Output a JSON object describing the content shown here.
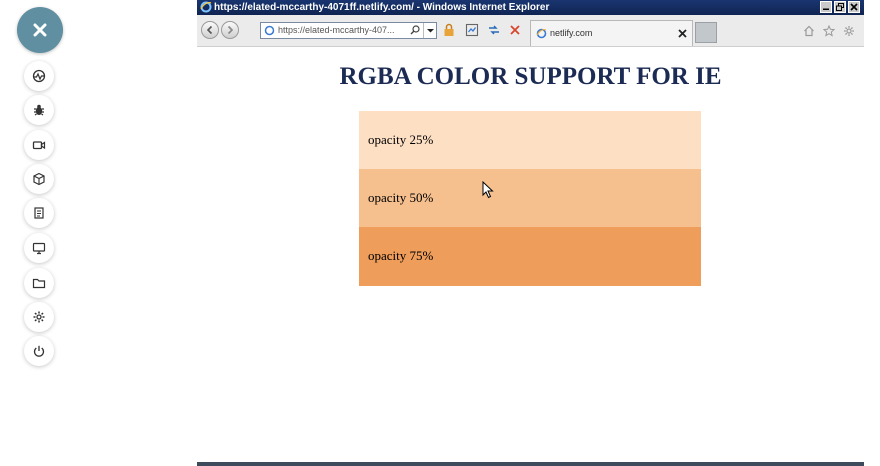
{
  "window": {
    "title": "https://elated-mccarthy-4071ff.netlify.com/ - Windows Internet Explorer"
  },
  "toolbar": {
    "address": "https://elated-mccarthy-407...",
    "tab_title": "netlify.com"
  },
  "page": {
    "heading": "RGBA COLOR SUPPORT FOR IE",
    "swatches": [
      {
        "label": "opacity 25%",
        "color": "#fddfc4"
      },
      {
        "label": "opacity 50%",
        "color": "#f5bf8e"
      },
      {
        "label": "opacity 75%",
        "color": "#ee9d5a"
      }
    ]
  },
  "colors": {
    "rail_button": "#5f8fa0",
    "titlebar": "#1a3570",
    "heading": "#1c2b53"
  },
  "icons": {
    "rail": [
      "close-icon",
      "speedometer-icon",
      "bug-icon",
      "video-icon",
      "cube-icon",
      "notepad-icon",
      "monitor-icon",
      "folder-icon",
      "gear-icon",
      "power-icon"
    ]
  }
}
